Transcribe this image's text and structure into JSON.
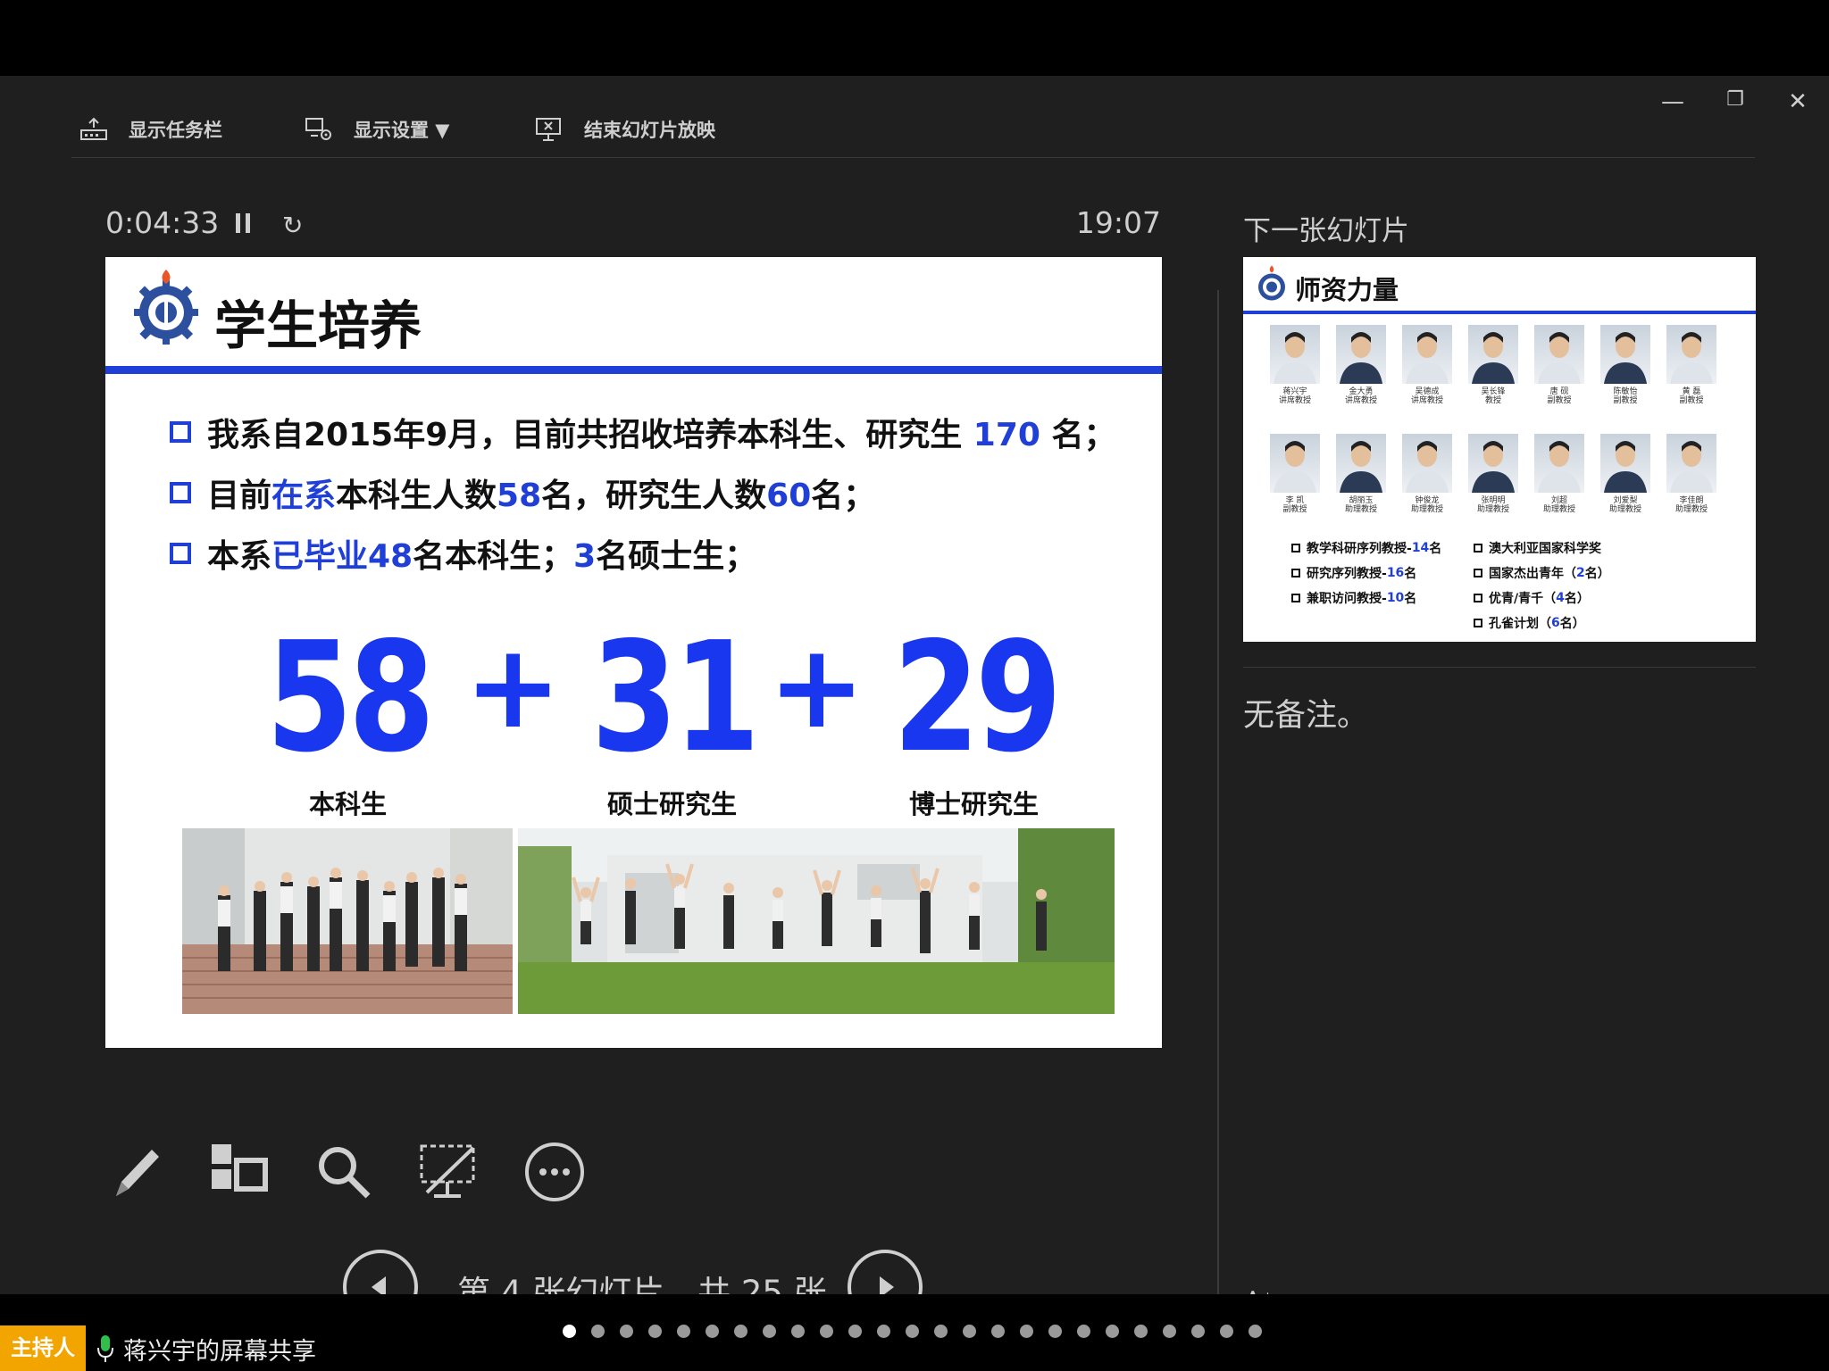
{
  "toolbar": {
    "show_taskbar": "显示任务栏",
    "display_settings": "显示设置 ▼",
    "end_slideshow": "结束幻灯片放映"
  },
  "window_controls": {
    "minimize": "—",
    "restore": "❐",
    "close": "✕"
  },
  "presenter": {
    "elapsed": "0:04:33",
    "clock": "19:07",
    "next_slide_label": "下一张幻灯片",
    "notes": "无备注。",
    "slide_counter": "第 4 张幻灯片，共 25 张",
    "progress": 0.16,
    "font_increase": "A",
    "font_decrease": "A"
  },
  "current_slide": {
    "title": "学生培养",
    "bullets": [
      {
        "parts": [
          {
            "t": "我系自2015年9月，目前共招收培养本科生、研究生 ",
            "blue": false
          },
          {
            "t": "170",
            "blue": true
          },
          {
            "t": " 名；",
            "blue": false
          }
        ]
      },
      {
        "parts": [
          {
            "t": "目前",
            "blue": false
          },
          {
            "t": "在系",
            "blue": true
          },
          {
            "t": "本科生人数",
            "blue": false
          },
          {
            "t": "58",
            "blue": true
          },
          {
            "t": "名，研究生人数",
            "blue": false
          },
          {
            "t": "60",
            "blue": true
          },
          {
            "t": "名；",
            "blue": false
          }
        ]
      },
      {
        "parts": [
          {
            "t": "本系",
            "blue": false
          },
          {
            "t": "已毕业48",
            "blue": true
          },
          {
            "t": "名本科生；",
            "blue": false
          },
          {
            "t": "3",
            "blue": true
          },
          {
            "t": "名硕士生；",
            "blue": false
          }
        ]
      }
    ],
    "numbers": [
      "58",
      "31",
      "29"
    ],
    "plus": "+",
    "categories": [
      "本科生",
      "硕士研究生",
      "博士研究生"
    ]
  },
  "next_slide": {
    "title": "师资力量",
    "faculty_row1": [
      {
        "name": "蒋兴宇",
        "role": "讲席教授"
      },
      {
        "name": "金大勇",
        "role": "讲席教授"
      },
      {
        "name": "吴德成",
        "role": "讲席教授"
      },
      {
        "name": "吴长锋",
        "role": "教授"
      },
      {
        "name": "唐 砚",
        "role": "副教授"
      },
      {
        "name": "陈敏怡",
        "role": "副教授"
      },
      {
        "name": "黄 磊",
        "role": "副教授"
      }
    ],
    "faculty_row2": [
      {
        "name": "李 凯",
        "role": "副教授"
      },
      {
        "name": "胡丽玉",
        "role": "助理教授"
      },
      {
        "name": "钟俊龙",
        "role": "助理教授"
      },
      {
        "name": "张明明",
        "role": "助理教授"
      },
      {
        "name": "刘超",
        "role": "助理教授"
      },
      {
        "name": "刘爱梨",
        "role": "助理教授"
      },
      {
        "name": "李佳朗",
        "role": "助理教授"
      }
    ],
    "stats_left": [
      {
        "label": "教学科研序列教授-",
        "count": "14",
        "suffix": "名"
      },
      {
        "label": "研究序列教授-",
        "count": "16",
        "suffix": "名"
      },
      {
        "label": "兼职访问教授-",
        "count": "10",
        "suffix": "名"
      }
    ],
    "stats_right": [
      {
        "label": "澳大利亚国家科学奖",
        "count": "",
        "suffix": ""
      },
      {
        "label": "国家杰出青年（",
        "count": "2",
        "suffix": "名）"
      },
      {
        "label": "优青/青千（",
        "count": "4",
        "suffix": "名）"
      },
      {
        "label": "孔雀计划（",
        "count": "6",
        "suffix": "名）"
      }
    ]
  },
  "bottom_bar": {
    "host_badge": "主持人",
    "share_text": "蒋兴宇的屏幕共享",
    "page_dots": 25,
    "active_dot": 0
  },
  "colors": {
    "accent_blue": "#1f3fd6",
    "number_blue": "#1a37f0",
    "host_orange": "#f2a400"
  }
}
